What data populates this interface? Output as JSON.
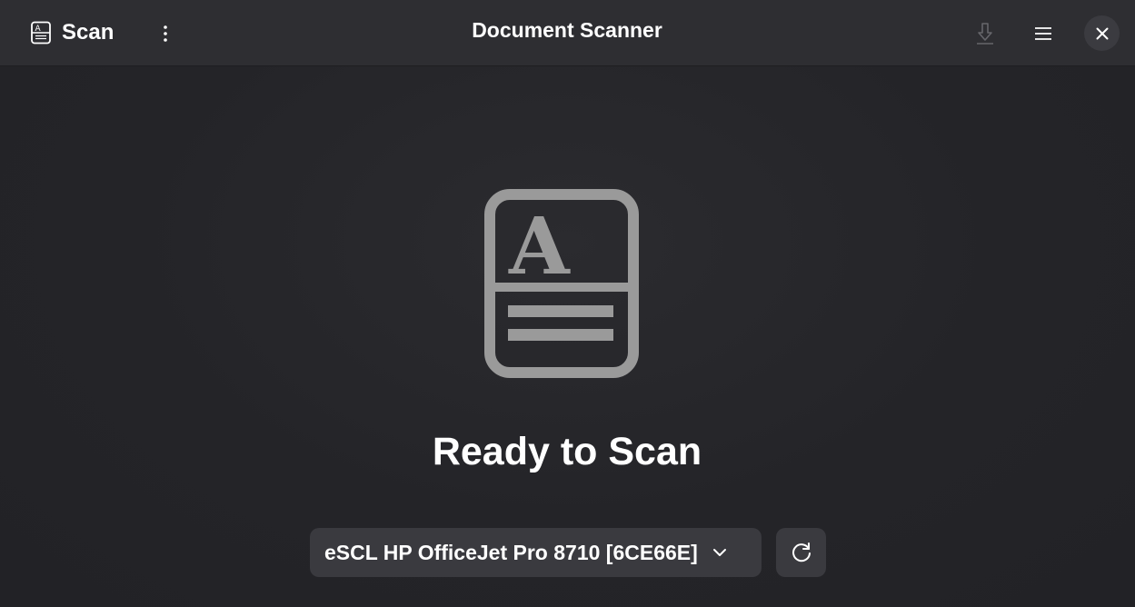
{
  "header": {
    "app_label": "Scan",
    "title": "Document Scanner",
    "icons": {
      "app": "document-scan-icon",
      "kebab": "vertical-dots-icon",
      "save": "download-icon",
      "menu": "hamburger-menu-icon",
      "close": "close-icon"
    }
  },
  "status": {
    "title": "Ready to Scan",
    "icon": "document-icon"
  },
  "device": {
    "selected": "eSCL HP OfficeJet Pro 8710 [6CE66E]",
    "refresh_icon": "refresh-icon"
  },
  "colors": {
    "background": "#242428",
    "headerbar": "#2e2e32",
    "button": "#3a3a3f",
    "icon_gray": "#9a9a9a"
  }
}
